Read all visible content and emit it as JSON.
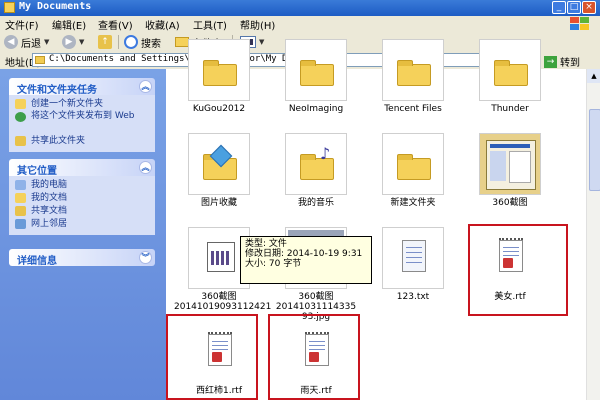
{
  "window": {
    "title": "My Documents",
    "controls": {
      "min": "_",
      "max": "□",
      "close": "×"
    }
  },
  "menu": [
    "文件(F)",
    "编辑(E)",
    "查看(V)",
    "收藏(A)",
    "工具(T)",
    "帮助(H)"
  ],
  "toolbar": {
    "back": "后退",
    "search": "搜索",
    "folders": "文件夹"
  },
  "address": {
    "label": "地址(D)",
    "path": "C:\\Documents and Settings\\Administrator\\My Documents",
    "go": "转到"
  },
  "tasks": {
    "file_tasks": {
      "title": "文件和文件夹任务",
      "items": [
        "创建一个新文件夹",
        "将这个文件夹发布到 Web",
        "共享此文件夹"
      ]
    },
    "other_places": {
      "title": "其它位置",
      "items": [
        "我的电脑",
        "我的文档",
        "共享文档",
        "网上邻居"
      ]
    },
    "details": {
      "title": "详细信息"
    }
  },
  "files": [
    {
      "name": "KuGou2012",
      "kind": "folder"
    },
    {
      "name": "NeoImaging",
      "kind": "folder"
    },
    {
      "name": "Tencent Files",
      "kind": "folder"
    },
    {
      "name": "Thunder",
      "kind": "folder"
    },
    {
      "name": "图片收藏",
      "kind": "folder-pictures"
    },
    {
      "name": "我的音乐",
      "kind": "folder-music"
    },
    {
      "name": "新建文件夹",
      "kind": "folder"
    },
    {
      "name": "360截图",
      "kind": "folder-preview"
    },
    {
      "name": "360截图\n20141019093112421",
      "kind": "image"
    },
    {
      "name": "360截图\n20141031114335 93.jpg",
      "kind": "image-screenshot"
    },
    {
      "name": "123.txt",
      "kind": "text"
    },
    {
      "name": "美女.rtf",
      "kind": "rtf"
    },
    {
      "name": "西红柿1.rtf",
      "kind": "rtf"
    },
    {
      "name": "雨天.rtf",
      "kind": "rtf"
    }
  ],
  "tooltip": {
    "type": "类型: 文件",
    "modified": "修改日期: 2014-10-19 9:31",
    "size": "大小: 70 字节"
  },
  "colors": {
    "highlight": "#c8141e",
    "task_pane": "#7aa2e6",
    "title_bar": "#1d5cc4"
  }
}
